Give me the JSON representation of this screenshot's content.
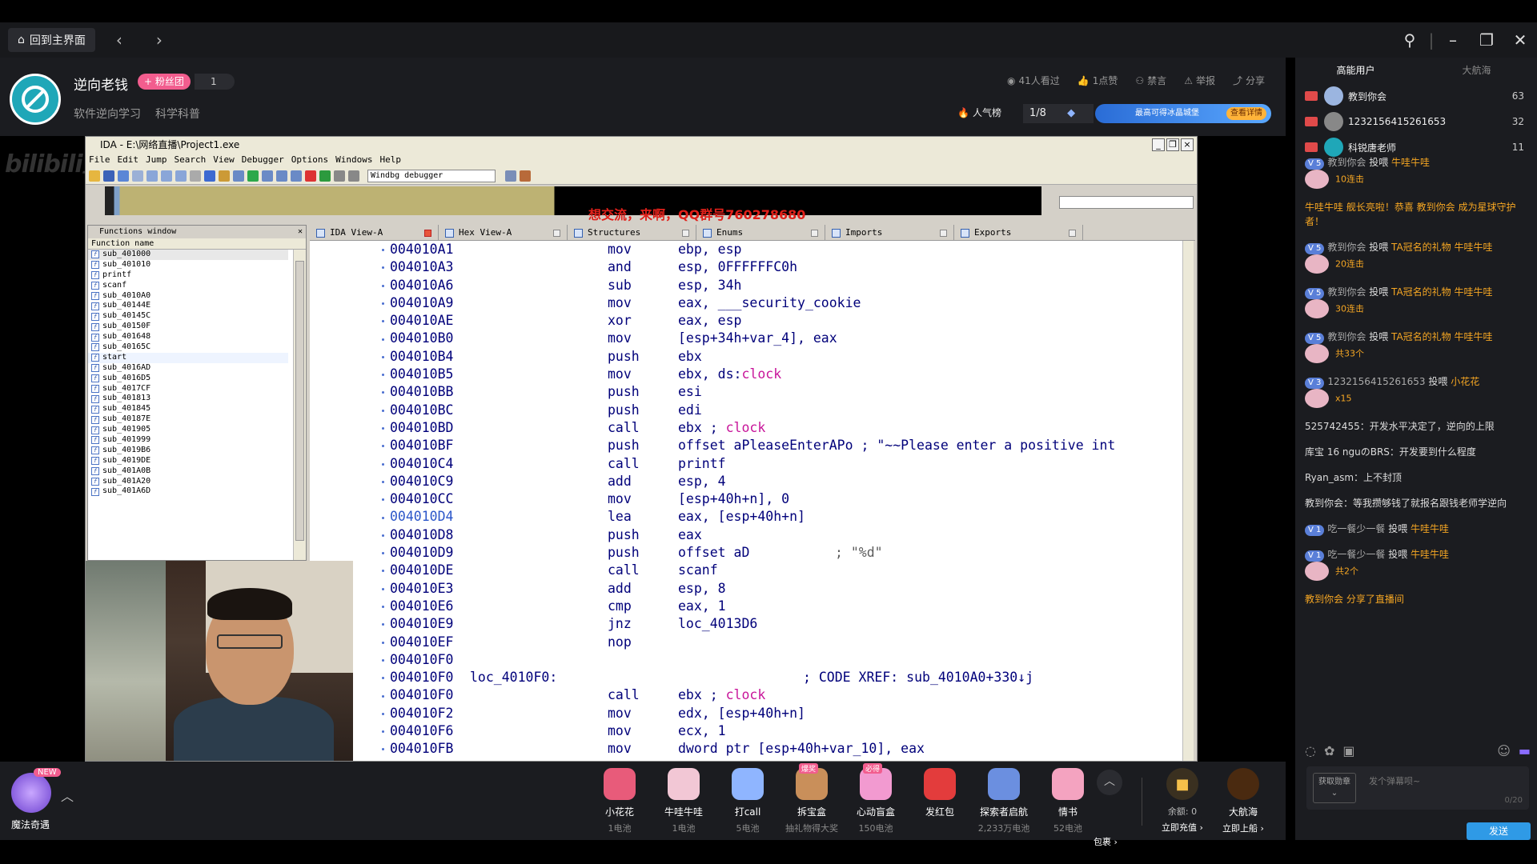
{
  "topbar": {
    "home_label": "回到主界面",
    "back_icon": "chevron-left-icon",
    "forward_icon": "chevron-right-icon"
  },
  "streamer": {
    "name": "逆向老钱",
    "fan_badge": "+ 粉丝团",
    "fan_count": "1",
    "tags": [
      "软件逆向学习",
      "科学科普"
    ],
    "stats": {
      "watched": "41人看过",
      "likes": "1点赞",
      "ban": "禁言",
      "report": "举报",
      "share": "分享"
    },
    "popularity_label": "人气榜",
    "rank": "1/8",
    "banner_text": "最高可得冰晶城堡",
    "banner_button": "查看详情"
  },
  "ida": {
    "title": "IDA - E:\\网络直播\\Project1.exe",
    "menu": [
      "File",
      "Edit",
      "Jump",
      "Search",
      "View",
      "Debugger",
      "Options",
      "Windows",
      "Help"
    ],
    "debugger": "Windbg debugger",
    "overlay": "想交流，来啊，QQ群号760278680",
    "functions_title": "Functions window",
    "functions_header": "Function name",
    "functions": [
      "sub_401000",
      "sub_401010",
      "printf",
      "scanf",
      "sub_4010A0",
      "sub_40144E",
      "sub_40145C",
      "sub_40150F",
      "sub_401648",
      "sub_40165C",
      "start",
      "sub_4016AD",
      "sub_4016D5",
      "sub_4017CF",
      "sub_401813",
      "sub_401845",
      "sub_40187E",
      "sub_401905",
      "sub_401999",
      "sub_4019B6",
      "sub_4019DE",
      "sub_401A0B",
      "sub_401A20",
      "sub_401A6D"
    ],
    "tabs": [
      "IDA View-A",
      "Hex View-A",
      "Structures",
      "Enums",
      "Imports",
      "Exports"
    ],
    "code": [
      {
        "addr": "004010A1",
        "mn": "mov",
        "ops": "ebp, esp"
      },
      {
        "addr": "004010A3",
        "mn": "and",
        "ops": "esp, 0FFFFFFC0h"
      },
      {
        "addr": "004010A6",
        "mn": "sub",
        "ops": "esp, 34h"
      },
      {
        "addr": "004010A9",
        "mn": "mov",
        "ops": "eax, ___security_cookie"
      },
      {
        "addr": "004010AE",
        "mn": "xor",
        "ops": "eax, esp"
      },
      {
        "addr": "004010B0",
        "mn": "mov",
        "ops": "[esp+34h+var_4], eax"
      },
      {
        "addr": "004010B4",
        "mn": "push",
        "ops": "ebx"
      },
      {
        "addr": "004010B5",
        "mn": "mov",
        "ops": "ebx, ds:",
        "red": "clock"
      },
      {
        "addr": "004010BB",
        "mn": "push",
        "ops": "esi"
      },
      {
        "addr": "004010BC",
        "mn": "push",
        "ops": "edi"
      },
      {
        "addr": "004010BD",
        "mn": "call",
        "ops": "ebx ; ",
        "red": "clock"
      },
      {
        "addr": "004010BF",
        "mn": "push",
        "ops": "offset aPleaseEnterAPo ; \"~~Please enter a positive int"
      },
      {
        "addr": "004010C4",
        "mn": "call",
        "ops": "printf"
      },
      {
        "addr": "004010C9",
        "mn": "add",
        "ops": "esp, 4"
      },
      {
        "addr": "004010CC",
        "mn": "mov",
        "ops": "[esp+40h+n], 0"
      },
      {
        "addr": "004010D4",
        "mn": "lea",
        "ops": "eax, [esp+40h+n]",
        "cur": true
      },
      {
        "addr": "004010D8",
        "mn": "push",
        "ops": "eax"
      },
      {
        "addr": "004010D9",
        "mn": "push",
        "ops": "offset aD",
        "cmt": "; \"%d\""
      },
      {
        "addr": "004010DE",
        "mn": "call",
        "ops": "scanf"
      },
      {
        "addr": "004010E3",
        "mn": "add",
        "ops": "esp, 8"
      },
      {
        "addr": "004010E6",
        "mn": "cmp",
        "ops": "eax, 1"
      },
      {
        "addr": "004010E9",
        "mn": "jnz",
        "ops": "loc_4013D6"
      },
      {
        "addr": "004010EF",
        "mn": "nop",
        "ops": ""
      },
      {
        "addr": "004010F0",
        "mn": "",
        "ops": ""
      },
      {
        "addr": "004010F0",
        "label": "loc_4010F0:",
        "mn": "",
        "ops": "",
        "xref": "; CODE XREF: sub_4010A0+330↓j"
      },
      {
        "addr": "004010F0",
        "mn": "call",
        "ops": "ebx ; ",
        "red": "clock"
      },
      {
        "addr": "004010F2",
        "mn": "mov",
        "ops": "edx, [esp+40h+n]"
      },
      {
        "addr": "004010F6",
        "mn": "mov",
        "ops": "ecx, 1"
      },
      {
        "addr": "004010FB",
        "mn": "mov",
        "ops": "dword ptr [esp+40h+var_10], eax"
      }
    ]
  },
  "gifts": {
    "magic_label": "魔法奇遇",
    "new_badge": "NEW",
    "items": [
      {
        "name": "小花花",
        "price": "1电池",
        "color": "#e85b7a"
      },
      {
        "name": "牛哇牛哇",
        "price": "1电池",
        "color": "#f2c7d5"
      },
      {
        "name": "打call",
        "price": "5电池",
        "color": "#8fb5ff"
      },
      {
        "name": "拆宝盒",
        "price": "抽礼物得大奖",
        "color": "#c98f5a",
        "tag": "爆奖"
      },
      {
        "name": "心动盲盒",
        "price": "150电池",
        "color": "#f29ad0",
        "tag": "必得"
      },
      {
        "name": "发红包",
        "price": "",
        "color": "#e33c3c"
      },
      {
        "name": "探索者启航",
        "price": "2,233万电池",
        "color": "#6b8fe0"
      },
      {
        "name": "情书",
        "price": "52电池",
        "color": "#f4a3c0"
      }
    ],
    "more_label": "包裹 ›",
    "balance": "余额: 0",
    "recharge": "立即充值 ›",
    "captain": "大航海",
    "captain_action": "立即上船 ›"
  },
  "panel": {
    "tabs": [
      "高能用户",
      "大航海"
    ],
    "top_users": [
      {
        "name": "教到你会",
        "score": "63",
        "color": "#9bb5e0"
      },
      {
        "name": "1232156415261653",
        "score": "32",
        "color": "#888"
      },
      {
        "name": "科锐唐老师",
        "score": "11",
        "color": "#1fa7b8"
      }
    ],
    "chat": [
      {
        "lv": "5",
        "user": "教到你会",
        "action": "投喂",
        "gift": "牛哇牛哇",
        "combo": "10连击"
      },
      {
        "sys": "牛哇牛哇 舰长亮啦！恭喜 教到你会 成为星球守护者！"
      },
      {
        "lv": "5",
        "user": "教到你会",
        "action": "投喂",
        "gift": "TA冠名的礼物 牛哇牛哇",
        "combo": "20连击"
      },
      {
        "lv": "5",
        "user": "教到你会",
        "action": "投喂",
        "gift": "TA冠名的礼物 牛哇牛哇",
        "combo": "30连击"
      },
      {
        "lv": "5",
        "user": "教到你会",
        "action": "投喂",
        "gift": "TA冠名的礼物 牛哇牛哇",
        "combo": "共33个"
      },
      {
        "lv": "3",
        "user": "1232156415261653",
        "action": "投喂",
        "gift": "小花花",
        "combo": "x15"
      },
      {
        "text": "525742455：开发水平决定了，逆向的上限"
      },
      {
        "text": "库宝 16 nguのBRS：开发要到什么程度"
      },
      {
        "text": "Ryan_asm：上不封顶"
      },
      {
        "text": "教到你会：等我攒够钱了就报名跟钱老师学逆向"
      },
      {
        "lv": "1",
        "user": "吃一餐少一餐",
        "action": "投喂",
        "gift": "牛哇牛哇"
      },
      {
        "lv": "1",
        "user": "吃一餐少一餐",
        "action": "投喂",
        "gift": "牛哇牛哇",
        "combo": "共2个"
      },
      {
        "share": "教到你会 分享了直播间"
      }
    ],
    "medal_label": "获取勋章",
    "input_placeholder": "发个弹幕呗~",
    "counter": "0/20",
    "send": "发送"
  }
}
